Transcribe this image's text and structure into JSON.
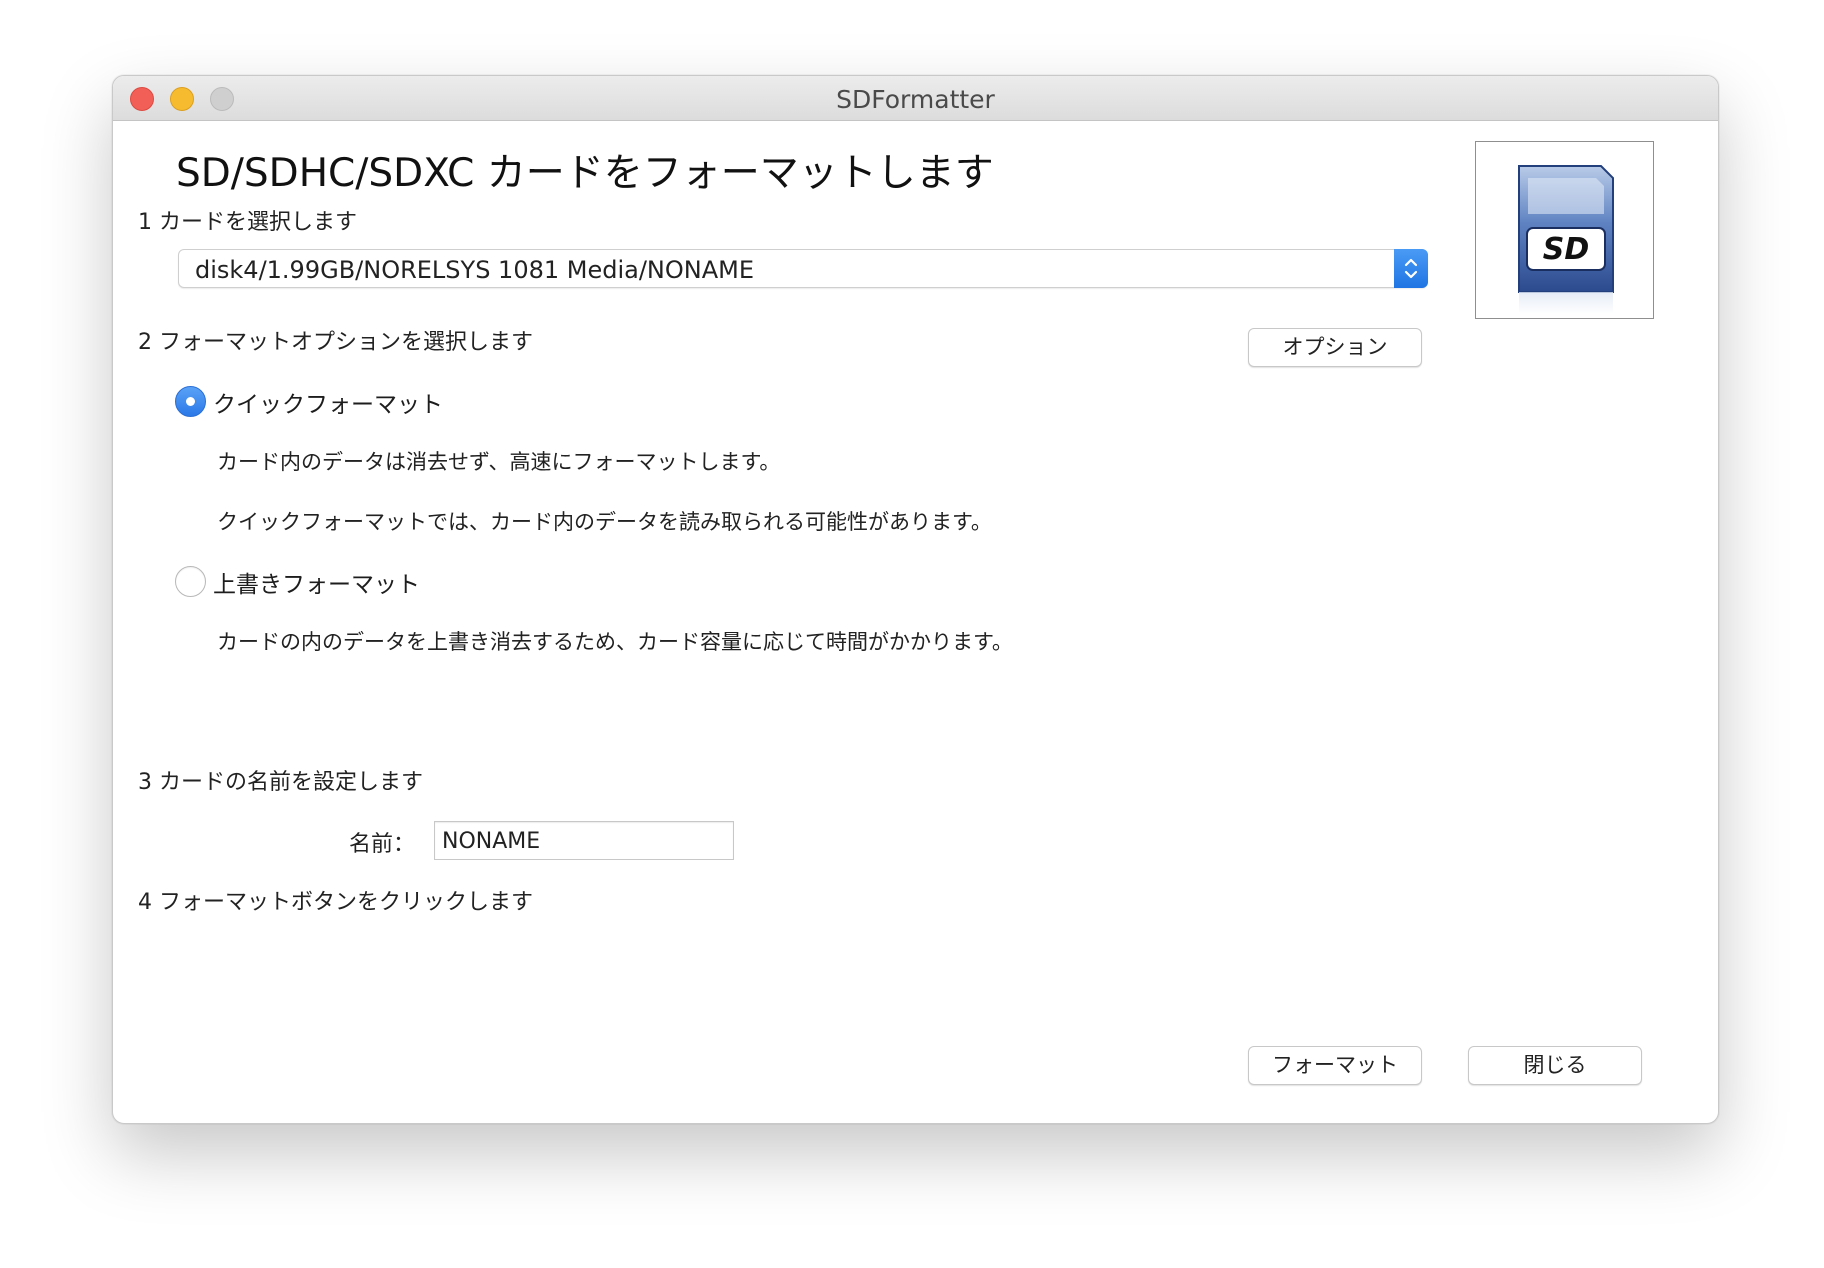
{
  "window": {
    "title": "SDFormatter"
  },
  "main": {
    "heading": "SD/SDHC/SDXC カードをフォーマットします",
    "step1_label": "1 カードを選択します",
    "card_select": {
      "value": "disk4/1.99GB/NORELSYS 1081 Media/NONAME"
    },
    "step2_label": "2 フォーマットオプションを選択します",
    "options_button": "オプション",
    "quick_format": {
      "label": "クイックフォーマット",
      "selected": true,
      "desc1": "カード内のデータは消去せず、高速にフォーマットします。",
      "desc2": "クイックフォーマットでは、カード内のデータを読み取られる可能性があります。"
    },
    "overwrite_format": {
      "label": "上書きフォーマット",
      "selected": false,
      "desc": "カードの内のデータを上書き消去するため、カード容量に応じて時間がかかります。"
    },
    "step3_label": "3 カードの名前を設定します",
    "name_label": "名前：",
    "name_value": "NONAME",
    "step4_label": "4 フォーマットボタンをクリックします",
    "format_button": "フォーマット",
    "close_button": "閉じる"
  },
  "icons": {
    "card_image": "sd-card-icon"
  },
  "colors": {
    "accent": "#2b78e8",
    "close": "#f25f57",
    "minimize": "#f7bb2f",
    "maximize": "#cfcfcf"
  }
}
